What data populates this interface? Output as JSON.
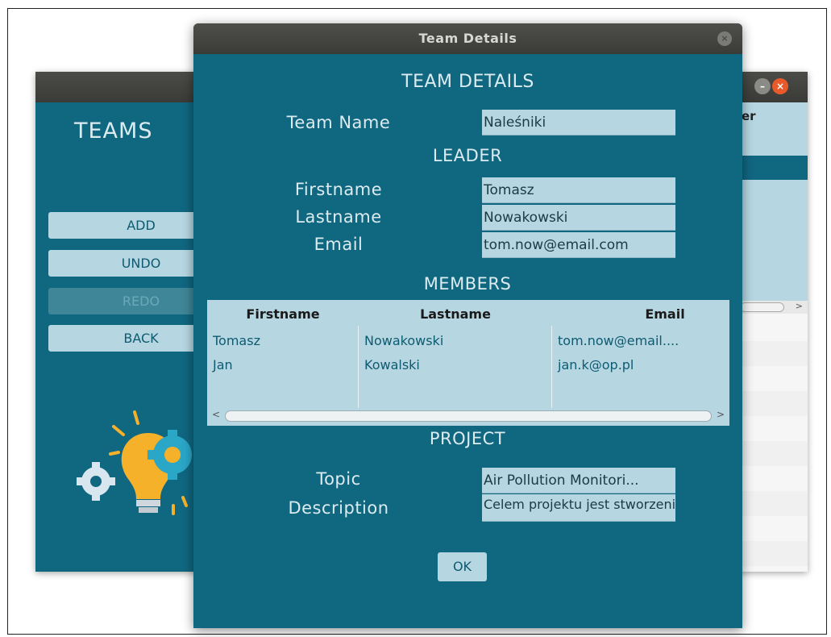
{
  "back_window": {
    "title": "TEAMS",
    "buttons": [
      {
        "label": "ADD",
        "enabled": true
      },
      {
        "label": "UNDO",
        "enabled": true
      },
      {
        "label": "REDO",
        "enabled": false
      },
      {
        "label": "BACK",
        "enabled": true
      }
    ]
  },
  "right_window": {
    "header_fragment": "er",
    "window_controls": [
      "minimize-icon",
      "close-icon"
    ]
  },
  "dialog": {
    "window_title": "Team Details",
    "heading": "TEAM DETAILS",
    "team_name_label": "Team Name",
    "team_name_value": "Naleśniki",
    "leader_heading": "LEADER",
    "leader": {
      "firstname_label": "Firstname",
      "firstname_value": "Tomasz",
      "lastname_label": "Lastname",
      "lastname_value": "Nowakowski",
      "email_label": "Email",
      "email_value": "tom.now@email.com"
    },
    "members_heading": "MEMBERS",
    "members_table": {
      "columns": [
        "Firstname",
        "Lastname",
        "Email"
      ],
      "rows": [
        [
          "Tomasz",
          "Nowakowski",
          "tom.now@email...."
        ],
        [
          "Jan",
          "Kowalski",
          "jan.k@op.pl"
        ]
      ]
    },
    "project_heading": "PROJECT",
    "project": {
      "topic_label": "Topic",
      "topic_value": "Air Pollution Monitori...",
      "description_label": "Description",
      "description_value": "Celem projektu jest stworzenie systemu"
    },
    "ok_label": "OK"
  }
}
